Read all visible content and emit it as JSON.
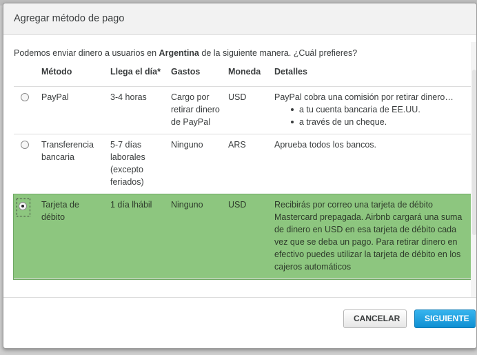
{
  "dialog": {
    "title": "Agregar método de pago",
    "intro_prefix": "Podemos enviar dinero a usuarios en ",
    "intro_country": "Argentina",
    "intro_suffix": " de la siguiente manera. ¿Cuál prefieres?"
  },
  "table": {
    "headers": {
      "method": "Método",
      "arrival": "Llega el día*",
      "fees": "Gastos",
      "currency": "Moneda",
      "details": "Detalles"
    },
    "rows": [
      {
        "method": "PayPal",
        "arrival": "3-4 horas",
        "fees": "Cargo por retirar dinero de PayPal",
        "currency": "USD",
        "details": "PayPal cobra una comisión por retirar dinero…",
        "bullets": [
          "a tu cuenta bancaria de EE.UU.",
          "a través de un cheque."
        ],
        "selected": false
      },
      {
        "method": "Transferencia bancaria",
        "arrival": "5-7 días laborales (excepto feriados)",
        "fees": "Ninguno",
        "currency": "ARS",
        "details": "Aprueba todos los bancos.",
        "selected": false
      },
      {
        "method": "Tarjeta de débito",
        "arrival": "1 día lhábil",
        "fees": "Ninguno",
        "currency": "USD",
        "details": "Recibirás por correo una tarjeta de débito Mastercard prepagada. Airbnb cargará una suma de dinero en USD en esa tarjeta de débito cada vez que se deba un pago. Para retirar dinero en efectivo puedes utilizar la tarjeta de débito en los cajeros automáticos",
        "selected": true
      }
    ]
  },
  "footer": {
    "cancel_label": "CANCELAR",
    "next_label": "SIGUIENTE"
  },
  "colors": {
    "selected_row": "#8dc67f",
    "primary_button": "#1a9ddc"
  }
}
